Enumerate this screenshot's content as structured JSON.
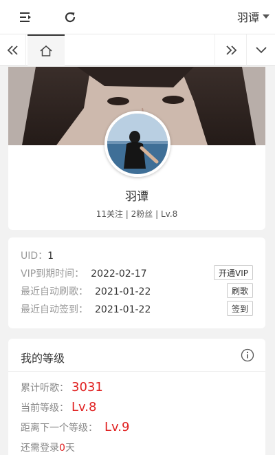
{
  "header": {
    "username": "羽谭"
  },
  "tabs": {
    "home": "home"
  },
  "profile": {
    "name": "羽谭",
    "stats": "11关注 | 2粉丝 | Lv.8"
  },
  "info": {
    "uid_label": "UID：",
    "uid_value": "1",
    "vip_label": "VIP到期时间：",
    "vip_value": "2022-02-17",
    "vip_button": "开通VIP",
    "song_label": "最近自动刷歌：",
    "song_value": "2021-01-22",
    "song_button": "刷歌",
    "sign_label": "最近自动签到：",
    "sign_value": "2021-01-22",
    "sign_button": "签到"
  },
  "level": {
    "title": "我的等级",
    "listen_label": "累计听歌：",
    "listen_value": "3031",
    "current_label": "当前等级：",
    "current_value": "Lv.8",
    "next_label": "距离下一个等级：",
    "next_value": "Lv.9",
    "login_prefix": "还需登录",
    "login_days": "0",
    "login_suffix": "天"
  },
  "colors": {
    "accent_red": "#e02020"
  }
}
